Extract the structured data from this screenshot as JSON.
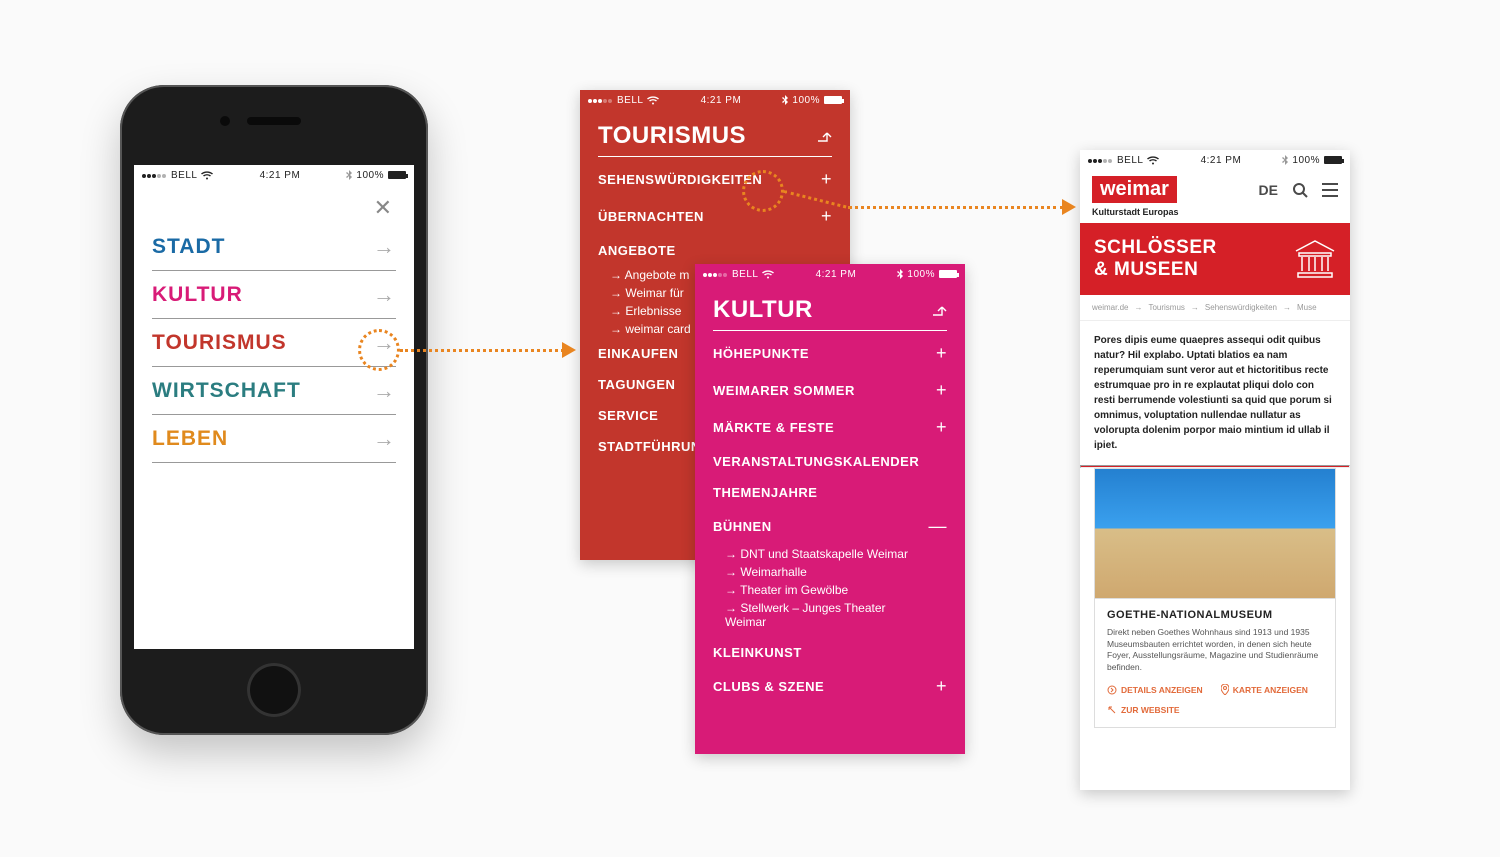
{
  "status": {
    "carrier": "BELL",
    "time": "4:21 PM",
    "battery": "100%"
  },
  "colors": {
    "stadt": "#1a6aa5",
    "kultur": "#d81b77",
    "tourismus": "#c2362c",
    "wirtschaft": "#2b7d80",
    "leben": "#e08a1d"
  },
  "screen1": {
    "items": [
      {
        "label": "STADT",
        "color": "stadt"
      },
      {
        "label": "KULTUR",
        "color": "kultur"
      },
      {
        "label": "TOURISMUS",
        "color": "tourismus"
      },
      {
        "label": "WIRTSCHAFT",
        "color": "wirtschaft"
      },
      {
        "label": "LEBEN",
        "color": "leben"
      }
    ]
  },
  "tourismus": {
    "title": "TOURISMUS",
    "items": {
      "sehens": "SEHENSWÜRDIGKEITEN",
      "uebernachten": "ÜBERNACHTEN",
      "angebote": "ANGEBOTE",
      "a1": "Angebote m",
      "a2": "Weimar für",
      "a3": "Erlebnisse",
      "a4": "weimar card",
      "einkaufen": "EINKAUFEN",
      "tagungen": "TAGUNGEN",
      "service": "SERVICE",
      "stadtf": "STADTFÜHRUN"
    }
  },
  "kultur": {
    "title": "KULTUR",
    "items": {
      "hoehe": "HÖHEPUNKTE",
      "sommer": "WEIMARER SOMMER",
      "maerkte": "MÄRKTE & FESTE",
      "kalender": "VERANSTALTUNGSKALENDER",
      "themen": "THEMENJAHRE",
      "buehnen": "BÜHNEN",
      "b1": "DNT und Staatskapelle Weimar",
      "b2": "Weimarhalle",
      "b3": "Theater im Gewölbe",
      "b4": "Stellwerk – Junges Theater Weimar",
      "klein": "KLEINKUNST",
      "clubs": "CLUBS & SZENE"
    }
  },
  "detail": {
    "logo": "weimar",
    "lang": "DE",
    "tagline": "Kulturstadt Europas",
    "banner_l1": "SCHLÖSSER",
    "banner_l2": "& MUSEEN",
    "breadcrumb": {
      "root": "weimar.de",
      "a": "Tourismus",
      "b": "Sehenswürdigkeiten",
      "c": "Muse"
    },
    "body": "Pores dipis eume quaepres assequi odit quibus natur? Hil explabo. Uptati blatios ea nam reperumquiam sunt veror aut et hictoritibus recte estrumquae pro in re explautat pliqui dolo con resti berrumende volestiunti sa quid que porum si omnimus, voluptation nullendae nullatur as volorupta dolenim porpor maio mintium id ullab il ipiet.",
    "card": {
      "title": "GOETHE-NATIONALMUSEUM",
      "text": "Direkt neben Goethes Wohnhaus sind 1913 und 1935 Museumsbauten errichtet worden, in denen sich heute Foyer, Ausstellungsräume, Magazine und Studienräume befinden.",
      "details": "DETAILS ANZEIGEN",
      "map": "KARTE ANZEIGEN",
      "site": "ZUR WEBSITE"
    }
  }
}
